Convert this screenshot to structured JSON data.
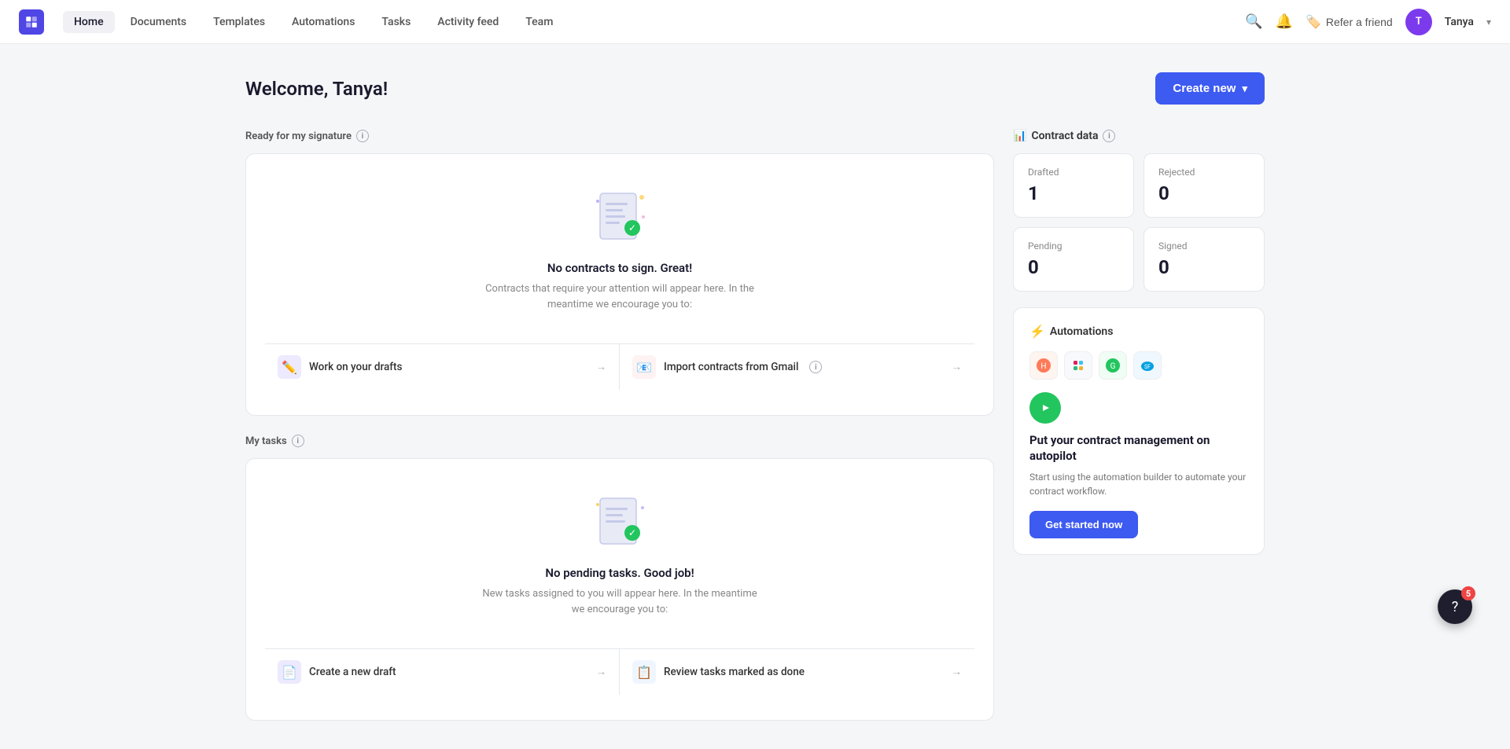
{
  "nav": {
    "logo_label": "Contractbook",
    "links": [
      {
        "label": "Home",
        "active": true
      },
      {
        "label": "Documents",
        "active": false
      },
      {
        "label": "Templates",
        "active": false
      },
      {
        "label": "Automations",
        "active": false
      },
      {
        "label": "Tasks",
        "active": false
      },
      {
        "label": "Activity feed",
        "active": false
      },
      {
        "label": "Team",
        "active": false
      }
    ],
    "refer_label": "Refer a friend",
    "user_name": "Tanya",
    "user_initials": "T"
  },
  "page": {
    "welcome": "Welcome, Tanya!",
    "create_btn": "Create new"
  },
  "signature_section": {
    "label": "Ready for my signature",
    "empty_title": "No contracts to sign. Great!",
    "empty_subtitle": "Contracts that require your attention will appear here. In the meantime we encourage you to:",
    "action1_label": "Work on your drafts",
    "action2_label": "Import contracts from Gmail"
  },
  "tasks_section": {
    "label": "My tasks",
    "empty_title": "No pending tasks. Good job!",
    "empty_subtitle": "New tasks assigned to you will appear here. In the meantime we encourage you to:",
    "action1_label": "Create a new draft",
    "action2_label": "Review tasks marked as done"
  },
  "contract_data": {
    "header": "Contract data",
    "tiles": [
      {
        "label": "Drafted",
        "value": "1"
      },
      {
        "label": "Rejected",
        "value": "0"
      },
      {
        "label": "Pending",
        "value": "0"
      },
      {
        "label": "Signed",
        "value": "0"
      }
    ]
  },
  "automations": {
    "header": "Automations",
    "integrations": [
      "🟠",
      "💬",
      "🟢"
    ],
    "autopilot_title": "Put your contract management on autopilot",
    "autopilot_desc": "Start using the automation builder to automate your contract workflow.",
    "cta_label": "Get started now"
  },
  "help": {
    "badge_count": "5"
  }
}
